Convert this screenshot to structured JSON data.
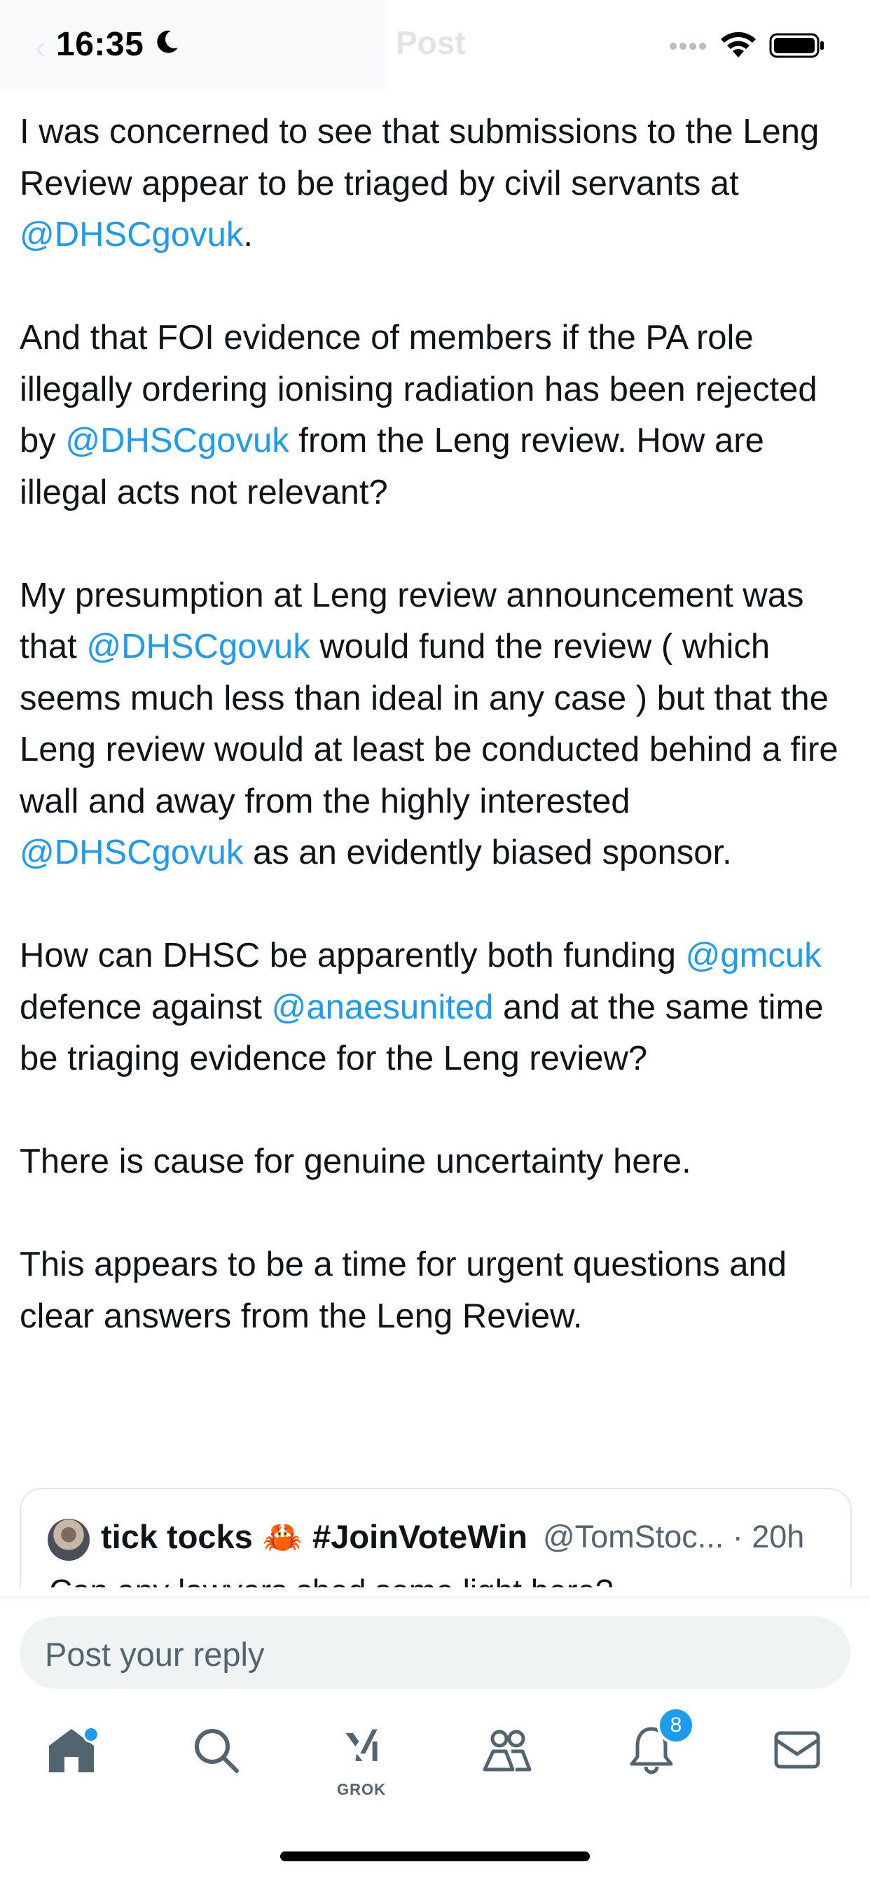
{
  "status_bar": {
    "time": "16:35",
    "icons": [
      "moon-icon",
      "signal-icon",
      "wifi-icon",
      "battery-icon"
    ]
  },
  "header": {
    "title": "Post"
  },
  "tweet": {
    "paragraphs": [
      [
        {
          "t": "I was concerned to see that submissions to the Leng Review appear to be triaged by civil servants at "
        },
        {
          "t": "@DHSCgovuk",
          "m": true
        },
        {
          "t": "."
        }
      ],
      [
        {
          "t": "And that FOI evidence of members if the PA role illegally ordering ionising radiation has been rejected by "
        },
        {
          "t": "@DHSCgovuk",
          "m": true
        },
        {
          "t": " from the Leng review. How are illegal acts not relevant?"
        }
      ],
      [
        {
          "t": "My presumption at Leng review announcement was that "
        },
        {
          "t": "@DHSCgovuk",
          "m": true
        },
        {
          "t": " would fund the review ( which seems much less than ideal in any case ) but that the Leng review would at least be conducted behind a fire wall and away from the highly interested "
        },
        {
          "t": "@DHSCgovuk",
          "m": true
        },
        {
          "t": " as an evidently biased sponsor."
        }
      ],
      [
        {
          "t": "How can DHSC be apparently both funding "
        },
        {
          "t": "@gmcuk",
          "m": true
        },
        {
          "t": " defence against "
        },
        {
          "t": "@anaesunited",
          "m": true
        },
        {
          "t": " and at the same time be triaging evidence for the Leng review?"
        }
      ],
      [
        {
          "t": "There is cause for genuine uncertainty here."
        }
      ],
      [
        {
          "t": "This appears to be a time for urgent questions and clear answers from the Leng Review."
        }
      ]
    ]
  },
  "quoted_tweet": {
    "name_part1": "tick tocks",
    "emoji": "🦀",
    "name_part2": "#JoinVoteWin",
    "handle_time": "@TomStoc... · 20h",
    "text": "Can any lawyers shed some light here?"
  },
  "reply": {
    "placeholder": "Post your reply"
  },
  "nav": {
    "items": [
      {
        "name": "home",
        "icon": "home-icon"
      },
      {
        "name": "search",
        "icon": "search-icon"
      },
      {
        "name": "grok",
        "icon": "grok-icon",
        "label": "GROK"
      },
      {
        "name": "communities",
        "icon": "communities-icon"
      },
      {
        "name": "notifications",
        "icon": "bell-icon",
        "badge": "8"
      },
      {
        "name": "messages",
        "icon": "mail-icon"
      }
    ]
  },
  "colors": {
    "accent": "#1d9bf0",
    "text": "#0f1419",
    "secondary": "#536471",
    "input_bg": "#eff3f4"
  }
}
